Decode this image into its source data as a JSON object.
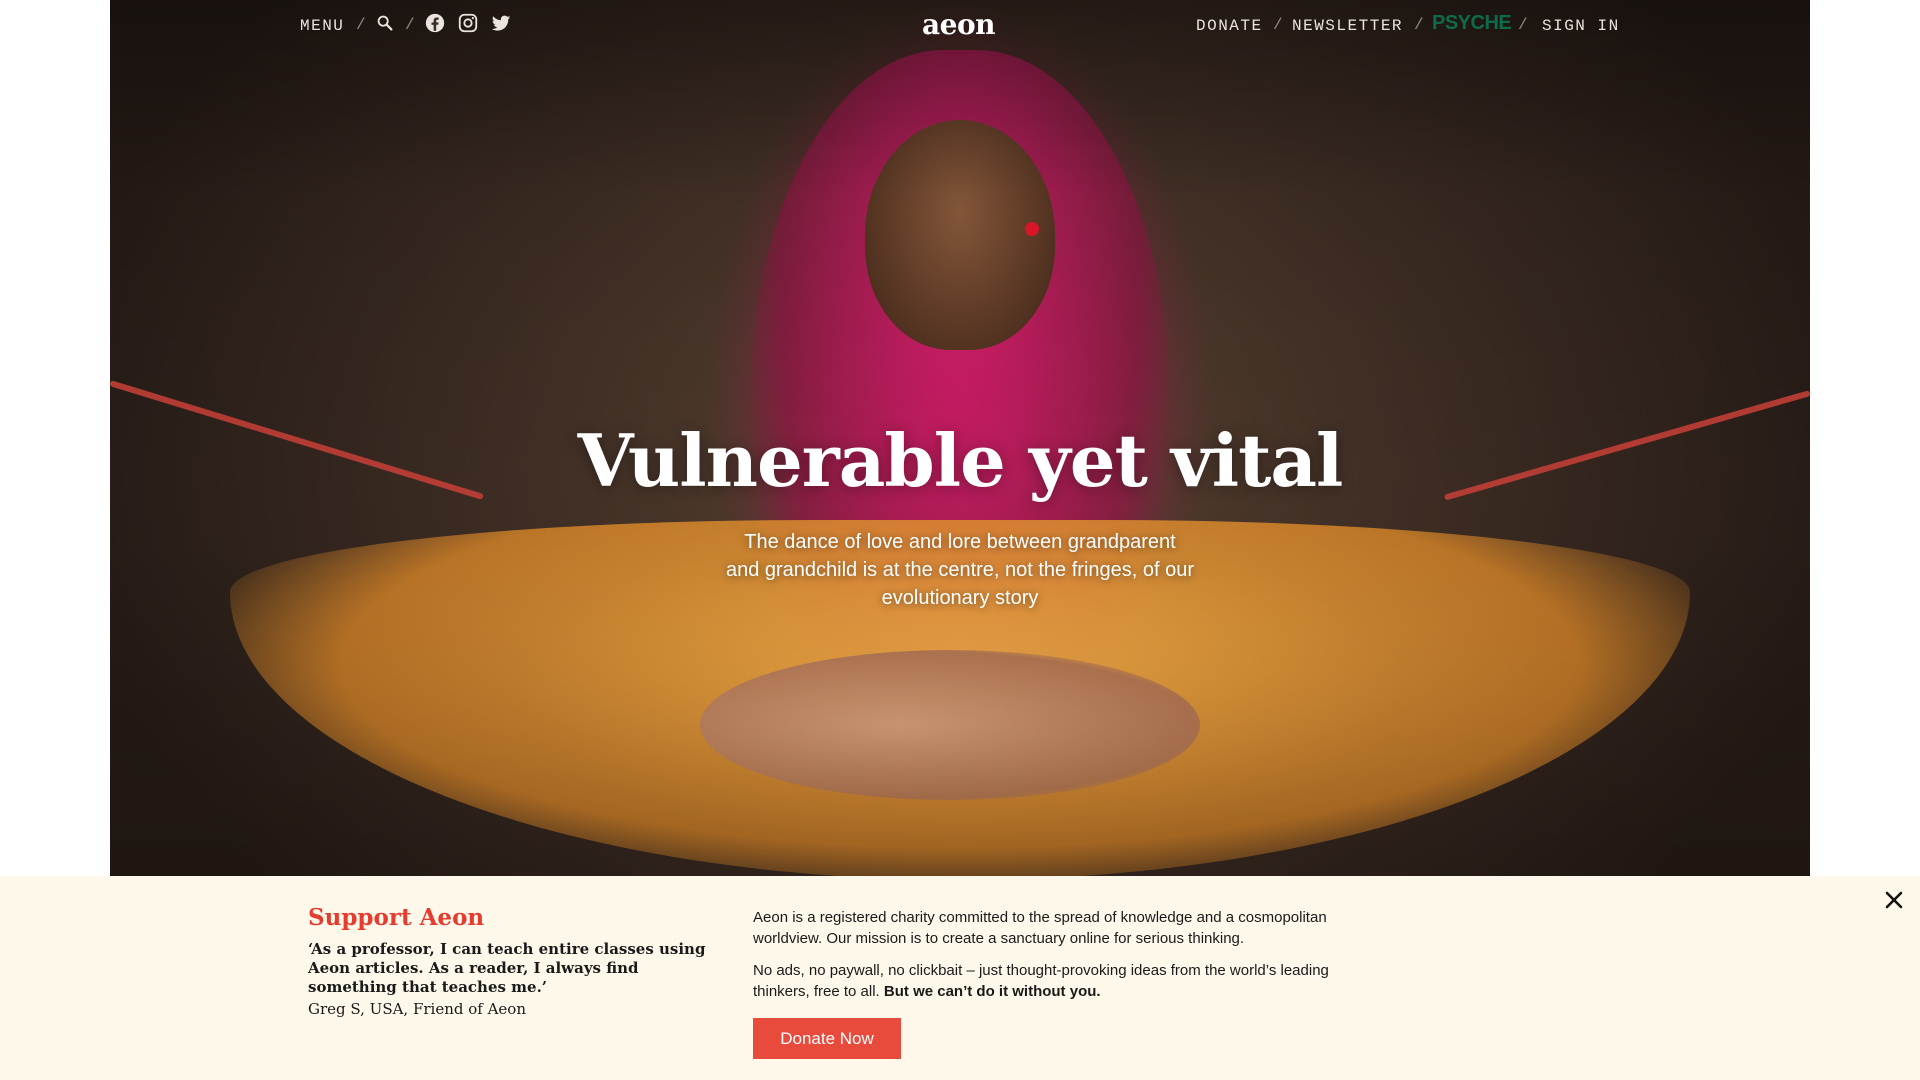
{
  "header": {
    "menu_label": "MENU",
    "separator": "/",
    "logo": "aeon",
    "donate_label": "DONATE",
    "newsletter_label": "NEWSLETTER",
    "psyche_label": "PSYCHE",
    "signin_label": "SIGN IN",
    "icons": [
      "search-icon",
      "facebook-icon",
      "instagram-icon",
      "twitter-icon"
    ]
  },
  "hero": {
    "title": "Vulnerable yet vital",
    "subtitle": "The dance of love and lore between grandparent and grandchild is at the centre, not the fringes, of our evolutionary story"
  },
  "support": {
    "title": "Support Aeon",
    "quote": "‘As a professor, I can teach entire classes using Aeon articles. As a reader, I always find something that teaches me.’",
    "attribution": "Greg S, USA, Friend of Aeon",
    "paragraph1": "Aeon is a registered charity committed to the spread of knowledge and a cosmopolitan worldview. Our mission is to create a sanctuary online for serious thinking.",
    "paragraph2": "No ads, no paywall, no clickbait – just thought-provoking ideas from the world’s leading thinkers, free to all.",
    "paragraph2_bold": "But we can’t do it without you.",
    "donate_button": "Donate Now"
  },
  "colors": {
    "accent_red": "#e43c2f",
    "button_red": "#e84a3b",
    "psyche_green": "#0d6b4a",
    "banner_bg": "#fdf8ea"
  }
}
